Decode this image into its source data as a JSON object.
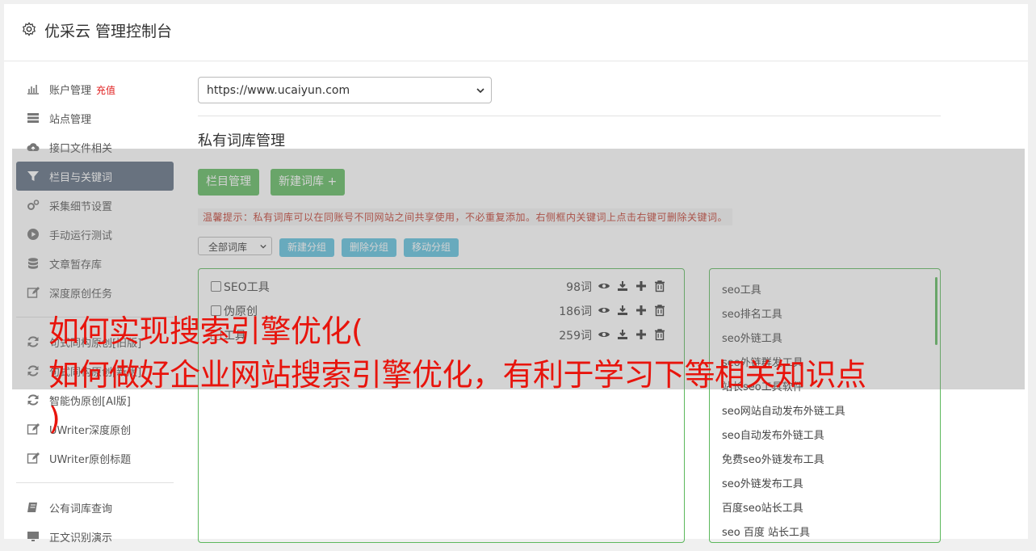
{
  "header": {
    "title": "优采云 管理控制台",
    "icon": "gear-icon"
  },
  "sidebar": {
    "items": [
      {
        "label": "账户管理",
        "badge": "充值",
        "icon": "bar-chart-icon"
      },
      {
        "label": "站点管理",
        "icon": "server-icon"
      },
      {
        "label": "接口文件相关",
        "icon": "cloud-upload-icon"
      },
      {
        "label": "栏目与关键词",
        "icon": "filter-icon",
        "active": true
      },
      {
        "label": "采集细节设置",
        "icon": "gears-icon"
      },
      {
        "label": "手动运行测试",
        "icon": "play-circle-icon"
      },
      {
        "label": "文章暂存库",
        "icon": "database-icon"
      },
      {
        "label": "深度原创任务",
        "icon": "edit-icon"
      },
      {
        "label": "句式同构原创[旧版]",
        "icon": "refresh-icon"
      },
      {
        "label": "句式同构原创[新版]",
        "icon": "refresh-icon"
      },
      {
        "label": "智能伪原创[AI版]",
        "icon": "refresh-icon"
      },
      {
        "label": "UWriter深度原创",
        "icon": "edit-icon"
      },
      {
        "label": "UWriter原创标题",
        "icon": "edit-icon"
      },
      {
        "label": "公有词库查询",
        "icon": "book-icon"
      },
      {
        "label": "正文识别演示",
        "icon": "monitor-icon"
      }
    ]
  },
  "main": {
    "site_select": "https://www.ucaiyun.com",
    "section_title": "私有词库管理",
    "buttons": {
      "column_manage": "栏目管理",
      "new_library": "新建词库 +"
    },
    "tip": "温馨提示：私有词库可以在同账号不同网站之间共享使用，不必重复添加。右侧框内关键词上点击右键可删除关键词。",
    "filter_select": "全部词库",
    "group_buttons": {
      "new_group": "新建分组",
      "delete_group": "删除分组",
      "move_group": "移动分组"
    },
    "libraries": [
      {
        "name": "SEO工具",
        "count": "98词"
      },
      {
        "name": "伪原创",
        "count": "186词"
      },
      {
        "name": "工具",
        "count": "259词"
      }
    ],
    "keywords": [
      "seo工具",
      "seo排名工具",
      "seo外链工具",
      "seo外链群发工具",
      "站长seo工具软件",
      "seo网站自动发布外链工具",
      "seo自动发布外链工具",
      "免费seo外链发布工具",
      "seo外链发布工具",
      "百度seo站长工具",
      "seo 百度 站长工具"
    ]
  },
  "overlay": {
    "line1": "如何实现搜索引擎优化(",
    "line2": "如何做好企业网站搜索引擎优化，有利于学习下等相关知识点",
    "line3": ")"
  },
  "colors": {
    "accent_green": "#5cb85c",
    "accent_blue": "#5bc0de",
    "active_nav": "#5b6b7e",
    "overlay_text": "#e8140c",
    "tip_red": "#c0392b"
  }
}
